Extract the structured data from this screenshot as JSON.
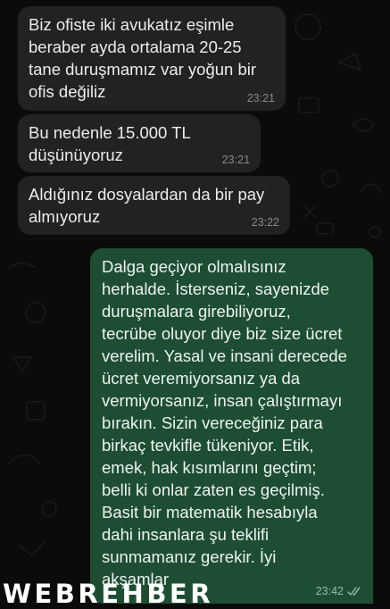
{
  "messages": [
    {
      "direction": "incoming",
      "text": "Biz ofiste iki avukatız eşimle\nberaber ayda ortalama 20-25\ntane duruşmamız var yoğun bir\nofis değiliz",
      "time": "23:21"
    },
    {
      "direction": "incoming",
      "text": "Bu nedenle 15.000 TL\ndüşünüyoruz",
      "time": "23:21"
    },
    {
      "direction": "incoming",
      "text": "Aldığınız dosyalardan da bir pay\nalmıyoruz",
      "time": "23:22"
    },
    {
      "direction": "outgoing",
      "text": "Dalga geçiyor olmalısınız\nherhalde. İsterseniz, sayenizde\nduruşmalara girebiliyoruz,\ntecrübe oluyor diye biz size ücret\nverelim. Yasal ve insani derecede\nücret veremiyorsanız ya da\nvermiyorsanız, insan çalıştırmayı\nbırakın. Sizin vereceğiniz para\nbirkaç tevkifle tükeniyor. Etik,\nemek, hak kısımlarını geçtim;\nbelli ki onlar zaten es geçilmiş.\nBasit bir matematik hesabıyla\ndahi insanlara şu teklifi\nsunmamanız gerekir. İyi\nakşamlar",
      "time": "23:42",
      "status_icon": "double-check-read-icon"
    }
  ],
  "watermark": {
    "text": "WEBREHBER"
  },
  "colors": {
    "background": "#0b0b0b",
    "incoming_bubble": "#222222",
    "outgoing_bubble": "#1d4e33",
    "text": "#ececec",
    "timestamp": "#8a8a8a"
  }
}
